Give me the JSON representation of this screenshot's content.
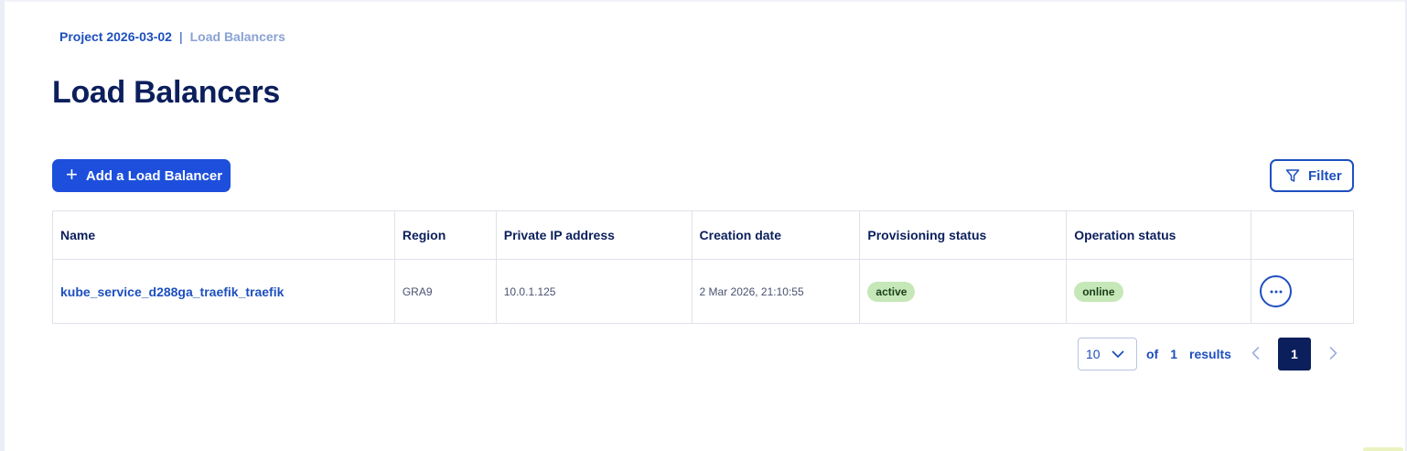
{
  "breadcrumb": {
    "project": "Project 2026-03-02",
    "separator": "|",
    "current": "Load Balancers"
  },
  "page": {
    "title": "Load Balancers"
  },
  "toolbar": {
    "add_label": "Add a Load Balancer",
    "add_icon": "plus-icon",
    "filter_label": "Filter",
    "filter_icon": "funnel-icon"
  },
  "table": {
    "columns": [
      "Name",
      "Region",
      "Private IP address",
      "Creation date",
      "Provisioning status",
      "Operation status",
      ""
    ],
    "rows": [
      {
        "name": "kube_service_d288ga_traefik_traefik",
        "region": "GRA9",
        "private_ip": "10.0.1.125",
        "creation_date": "2 Mar 2026, 21:10:55",
        "provisioning_status": "active",
        "operation_status": "online",
        "actions_icon": "more-horizontal-icon"
      }
    ]
  },
  "pagination": {
    "page_size": "10",
    "of_label": "of",
    "total_pages": "1",
    "results_label": "results",
    "current_page": "1"
  },
  "colors": {
    "primary": "#1d4fdc",
    "title": "#0b1f5c",
    "badge_green": "#c6e8b8"
  }
}
